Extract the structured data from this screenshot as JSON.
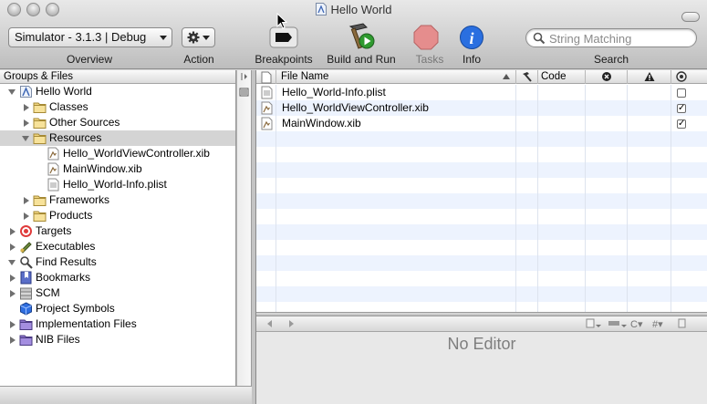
{
  "window": {
    "title": "Hello World"
  },
  "toolbar": {
    "overview_popup": "Simulator - 3.1.3 | Debug",
    "overview_label": "Overview",
    "action_label": "Action",
    "breakpoints_label": "Breakpoints",
    "build_run_label": "Build and Run",
    "tasks_label": "Tasks",
    "info_label": "Info",
    "search_label": "Search",
    "search_placeholder": "String Matching"
  },
  "groups": {
    "header": "Groups & Files",
    "items": [
      {
        "label": "Hello World",
        "icon": "xcode-project-icon",
        "state": "open",
        "depth": 0
      },
      {
        "label": "Classes",
        "icon": "folder-icon",
        "state": "closed",
        "depth": 1
      },
      {
        "label": "Other Sources",
        "icon": "folder-icon",
        "state": "closed",
        "depth": 1
      },
      {
        "label": "Resources",
        "icon": "folder-icon",
        "state": "open",
        "depth": 1,
        "selected": true
      },
      {
        "label": "Hello_WorldViewController.xib",
        "icon": "xib-file-icon",
        "state": "none",
        "depth": 2
      },
      {
        "label": "MainWindow.xib",
        "icon": "xib-file-icon",
        "state": "none",
        "depth": 2
      },
      {
        "label": "Hello_World-Info.plist",
        "icon": "plist-file-icon",
        "state": "none",
        "depth": 2
      },
      {
        "label": "Frameworks",
        "icon": "folder-icon",
        "state": "closed",
        "depth": 1
      },
      {
        "label": "Products",
        "icon": "folder-icon",
        "state": "closed",
        "depth": 1
      },
      {
        "label": "Targets",
        "icon": "target-icon",
        "state": "closed",
        "depth": 0
      },
      {
        "label": "Executables",
        "icon": "executable-icon",
        "state": "closed",
        "depth": 0
      },
      {
        "label": "Find Results",
        "icon": "magnifier-icon",
        "state": "open",
        "depth": 0
      },
      {
        "label": "Bookmarks",
        "icon": "bookmarks-icon",
        "state": "closed",
        "depth": 0
      },
      {
        "label": "SCM",
        "icon": "scm-icon",
        "state": "closed",
        "depth": 0
      },
      {
        "label": "Project Symbols",
        "icon": "cube-icon",
        "state": "none",
        "depth": 0
      },
      {
        "label": "Implementation Files",
        "icon": "smart-group-icon",
        "state": "closed",
        "depth": 0
      },
      {
        "label": "NIB Files",
        "icon": "smart-group-icon",
        "state": "closed",
        "depth": 0
      }
    ]
  },
  "files": {
    "columns": {
      "name": "File Name",
      "code": "Code"
    },
    "rows": [
      {
        "name": "Hello_World-Info.plist",
        "icon": "plist-file-icon",
        "checked": false
      },
      {
        "name": "Hello_WorldViewController.xib",
        "icon": "xib-file-icon",
        "checked": true
      },
      {
        "name": "MainWindow.xib",
        "icon": "xib-file-icon",
        "checked": true
      }
    ]
  },
  "editor": {
    "placeholder": "No Editor"
  }
}
